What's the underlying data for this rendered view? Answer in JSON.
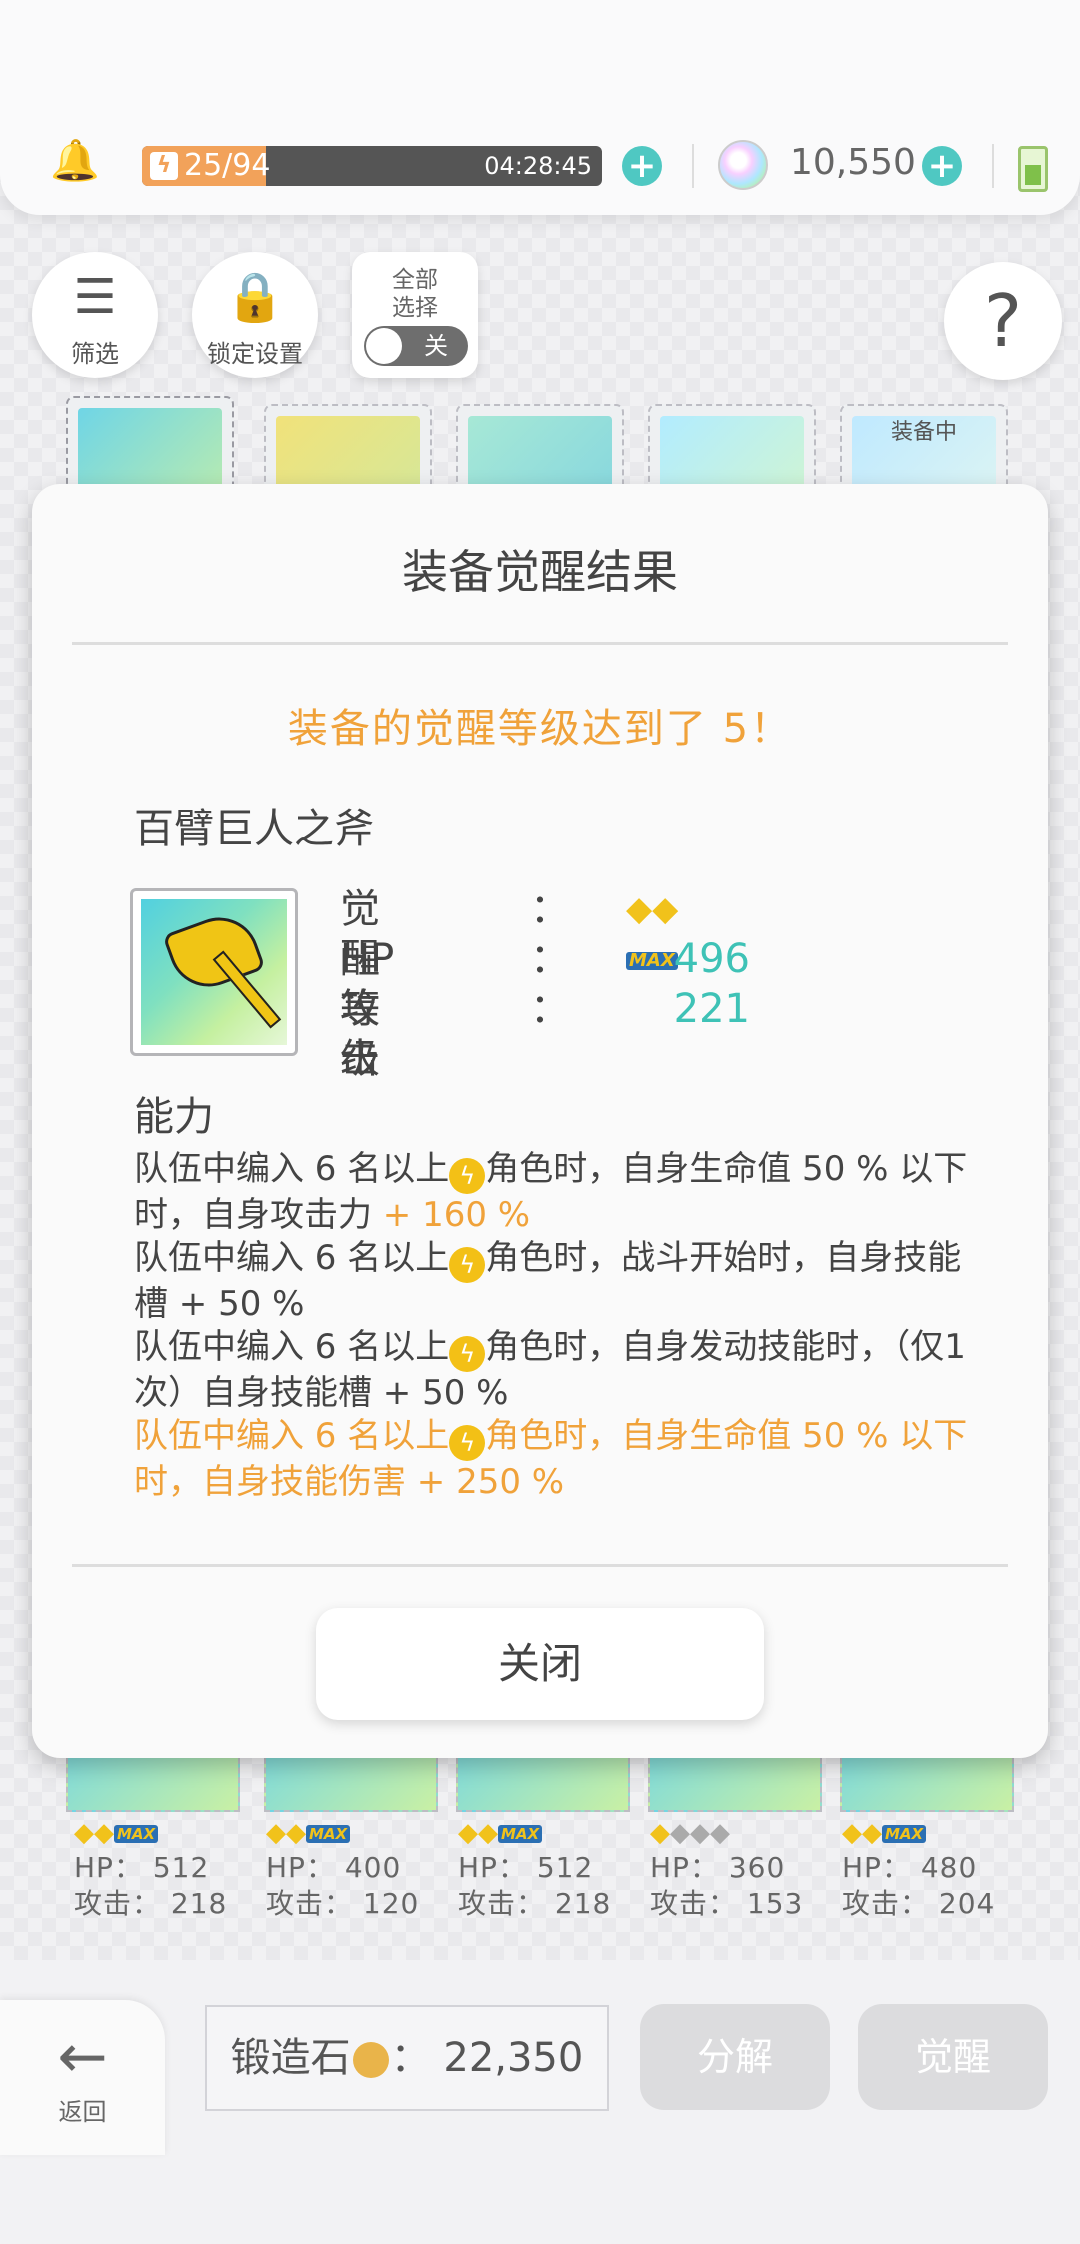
{
  "status": {
    "stamina": "25/94",
    "stamina_fraction": 0.27,
    "timer": "04:28:45",
    "gems": "10,550"
  },
  "toolbar": {
    "filter_label": "筛选",
    "lock_label": "锁定设置",
    "select_all_label": "全部选择",
    "toggle_label": "关",
    "help_label": "?"
  },
  "tiles_top": [
    {
      "tag": ""
    },
    {
      "tag": ""
    },
    {
      "tag": ""
    },
    {
      "tag": ""
    },
    {
      "tag": "装备中"
    }
  ],
  "tiles_bottom": [
    {
      "hp": "HP： 512",
      "atk": "攻击： 218",
      "stars_on": 2,
      "stars_off": 0,
      "max": "MAX"
    },
    {
      "hp": "HP： 400",
      "atk": "攻击： 120",
      "stars_on": 2,
      "stars_off": 0,
      "max": "MAX"
    },
    {
      "hp": "HP： 512",
      "atk": "攻击： 218",
      "stars_on": 2,
      "stars_off": 0,
      "max": "MAX"
    },
    {
      "hp": "HP： 360",
      "atk": "攻击： 153",
      "stars_on": 1,
      "stars_off": 3,
      "max": ""
    },
    {
      "hp": "HP： 480",
      "atk": "攻击： 204",
      "stars_on": 2,
      "stars_off": 0,
      "max": "MAX"
    }
  ],
  "modal": {
    "title": "装备觉醒结果",
    "notice": "装备的觉醒等级达到了 5！",
    "item_name": "百臂巨人之斧",
    "awaken_label": "觉醒等级",
    "colon": "：",
    "max_badge": "MAX",
    "hp_label": "HP",
    "hp_value": "496",
    "atk_label": "攻击",
    "atk_value": "221",
    "ability_title": "能力",
    "ab1_a": "队伍中编入 6 名以上",
    "ab1_b": "角色时，自身生命值 50 % 以下时，自身攻击力",
    "ab1_c": " + 160 %",
    "ab2_a": "队伍中编入 6 名以上",
    "ab2_b": "角色时，战斗开始时，自身技能槽 + 50 %",
    "ab3_a": "队伍中编入 6 名以上",
    "ab3_b": "角色时，自身发动技能时，（仅1次）自身技能槽 + 50 %",
    "ab4_a": "队伍中编入 6 名以上",
    "ab4_b": "角色时，自身生命值 50 % 以下时，自身技能伤害 + 250 %",
    "close_label": "关闭"
  },
  "bottom": {
    "back_label": "返回",
    "forge_label": "锻造石",
    "forge_value": "： 22,350",
    "decompose_label": "分解",
    "awaken_label": "觉醒"
  },
  "colors": {
    "accent": "#4fc8c2",
    "orange": "#f0a23a",
    "teal_value": "#3ec2b6"
  }
}
